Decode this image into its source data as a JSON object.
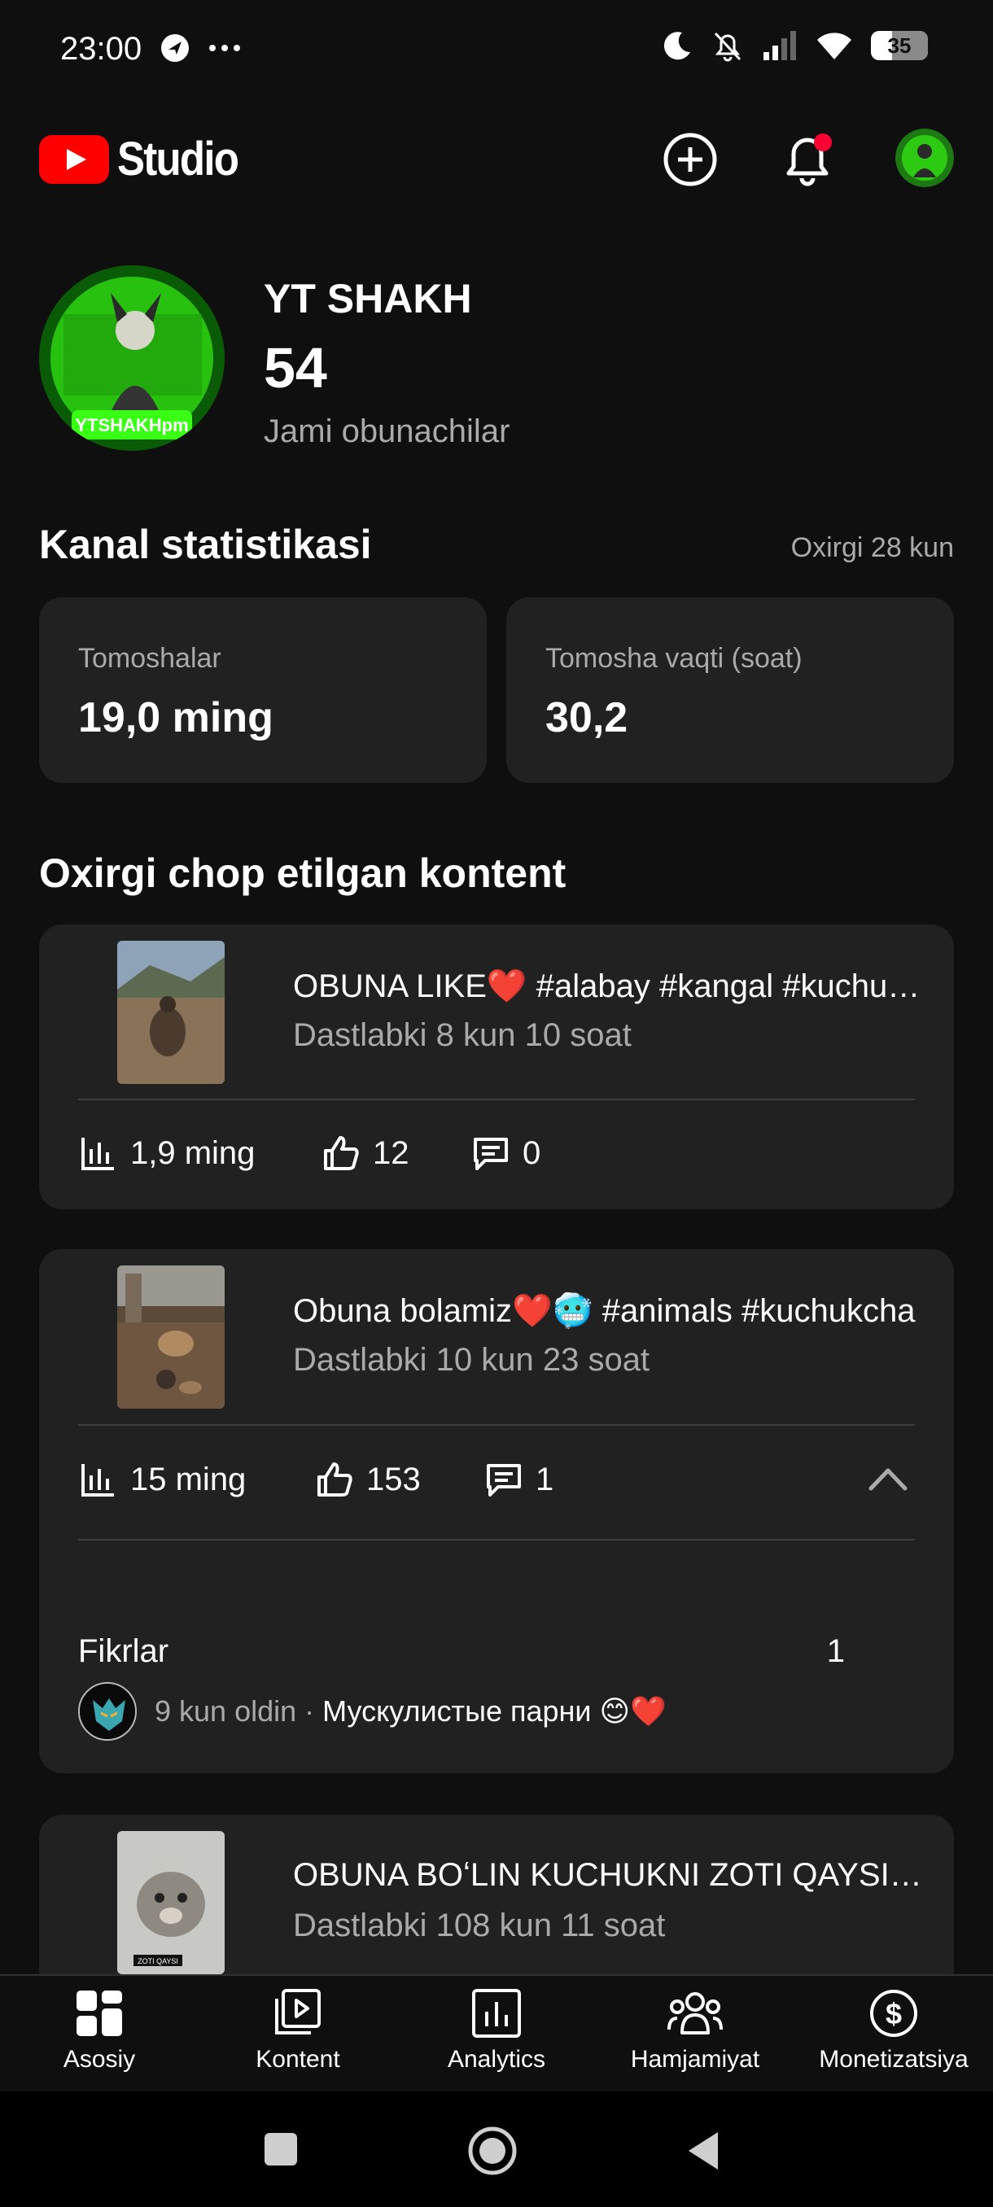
{
  "status_bar": {
    "time": "23:00",
    "battery": "35"
  },
  "colors": {
    "background": "#0f0f0f",
    "card": "#212121",
    "brand_red": "#ff0000",
    "muted_text": "#aaaaaa",
    "notification_dot": "#ff0033"
  },
  "header": {
    "logo_text": "Studio",
    "icons": [
      "create-icon",
      "bell-icon",
      "account-avatar"
    ]
  },
  "channel": {
    "name": "YT SHAKH",
    "avatar_text": "YTSHAKHpm",
    "subscriber_count": "54",
    "subscriber_label": "Jami obunachilar"
  },
  "stats": {
    "title": "Kanal statistikasi",
    "period": "Oxirgi 28 kun",
    "cards": [
      {
        "label": "Tomoshalar",
        "value": "19,0 ming"
      },
      {
        "label": "Tomosha vaqti (soat)",
        "value": "30,2"
      }
    ]
  },
  "recent": {
    "title": "Oxirgi chop etilgan kontent",
    "items": [
      {
        "title": "OBUNA LIKE❤️ #alabay #kangal #kuchukcha",
        "subtitle": "Dastlabki 8 kun 10 soat",
        "views": "1,9 ming",
        "likes": "12",
        "comments": "0"
      },
      {
        "title": "Obuna bolamiz❤️🥶 #animals #kuchukcha",
        "subtitle": "Dastlabki 10 kun 23 soat",
        "views": "15 ming",
        "likes": "153",
        "comments": "1",
        "comments_section": {
          "label": "Fikrlar",
          "count": "1",
          "comment_time": "9 kun oldin · ",
          "comment_text": "Мускулистые парни 😊❤️"
        }
      },
      {
        "title": "OBUNA BOʻLIN KUCHUKNI ZOTI QAYSI BILASIZMI",
        "subtitle": "Dastlabki 108 kun 11 soat",
        "thumb_caption": "ZOTI QAYSI"
      }
    ]
  },
  "bottom_nav": {
    "items": [
      "Asosiy",
      "Kontent",
      "Analytics",
      "Hamjamiyat",
      "Monetizatsiya"
    ]
  }
}
